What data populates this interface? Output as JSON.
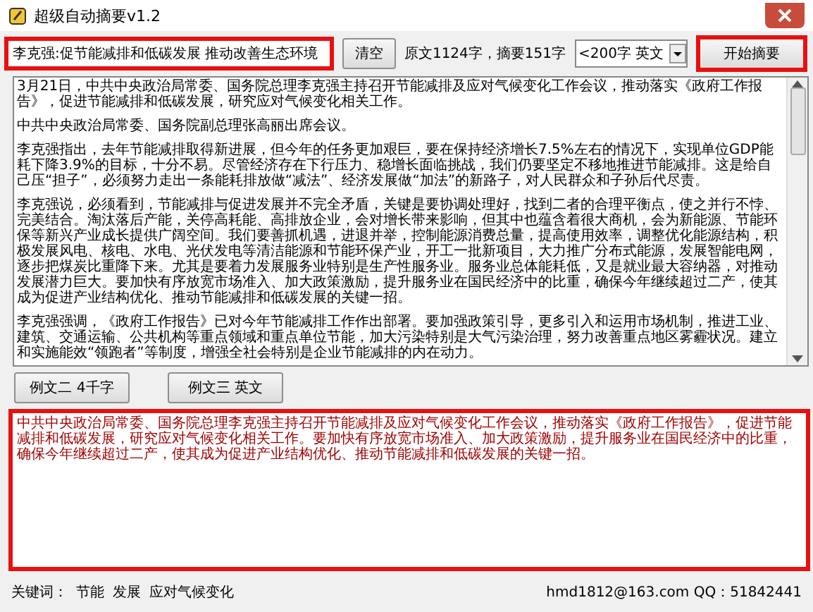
{
  "window": {
    "title": "超级自动摘要v1.2"
  },
  "toolbar": {
    "title_field": {
      "value": "李克强:促节能减排和低碳发展 推动改善生态环境",
      "highlighted": true
    },
    "clear_button": "清空",
    "stats": "原文1124字，摘要151字",
    "length_select": "<200字 英文",
    "start_button": {
      "label": "开始摘要",
      "highlighted": true
    }
  },
  "article": {
    "paragraphs": [
      "3月21日，中共中央政治局常委、国务院总理李克强主持召开节能减排及应对气候变化工作会议，推动落实《政府工作报告》，促进节能减排和低碳发展，研究应对气候变化相关工作。",
      "中共中央政治局常委、国务院副总理张高丽出席会议。",
      "李克强指出，去年节能减排取得新进展，但今年的任务更加艰巨，要在保持经济增长7.5%左右的情况下，实现单位GDP能耗下降3.9%的目标，十分不易。尽管经济存在下行压力、稳增长面临挑战，我们仍要坚定不移地推进节能减排。这是给自己压“担子”，必须努力走出一条能耗排放做“减法”、经济发展做“加法”的新路子，对人民群众和子孙后代尽责。",
      "李克强说，必须看到，节能减排与促进发展并不完全矛盾，关键是要协调处理好，找到二者的合理平衡点，使之并行不悖、完美结合。淘汰落后产能，关停高耗能、高排放企业，会对增长带来影响，但其中也蕴含着很大商机，会为新能源、节能环保等新兴产业成长提供广阔空间。我们要善抓机遇，进退并举，控制能源消费总量，提高使用效率，调整优化能源结构，积极发展风电、核电、水电、光伏发电等清洁能源和节能环保产业，开工一批新项目，大力推广分布式能源，发展智能电网，逐步把煤炭比重降下来。尤其是要着力发展服务业特别是生产性服务业。服务业总体能耗低，又是就业最大容纳器，对推动发展潜力巨大。要加快有序放宽市场准入、加大政策激励，提升服务业在国民经济中的比重，确保今年继续超过二产，使其成为促进产业结构优化、推动节能减排和低碳发展的关键一招。",
      "李克强强调，《政府工作报告》已对今年节能减排工作作出部署。要加强政策引导，更多引入和运用市场机制，推进工业、建筑、交通运输、公共机构等重点领域和重点单位节能，加大污染特别是大气污染治理，努力改善重点地区雾霾状况。建立和实施能效“领跑者”等制度，增强全社会特别是企业节能减排的内在动力。"
    ]
  },
  "example_buttons": [
    "例文二 4千字",
    "例文三 英文"
  ],
  "summary": {
    "text": "中共中央政治局常委、国务院总理李克强主持召开节能减排及应对气候变化工作会议，推动落实《政府工作报告》，促进节能减排和低碳发展，研究应对气候变化相关工作。要加快有序放宽市场准入、加大政策激励，提升服务业在国民经济中的比重，确保今年继续超过二产，使其成为促进产业结构优化、推动节能减排和低碳发展的关键一招。",
    "highlighted": true
  },
  "status_bar": {
    "keywords_label": "关键词：",
    "keywords": [
      "节能",
      "发展",
      "应对气候变化"
    ],
    "contact": "hmd1812@163.com  QQ：51842441"
  }
}
